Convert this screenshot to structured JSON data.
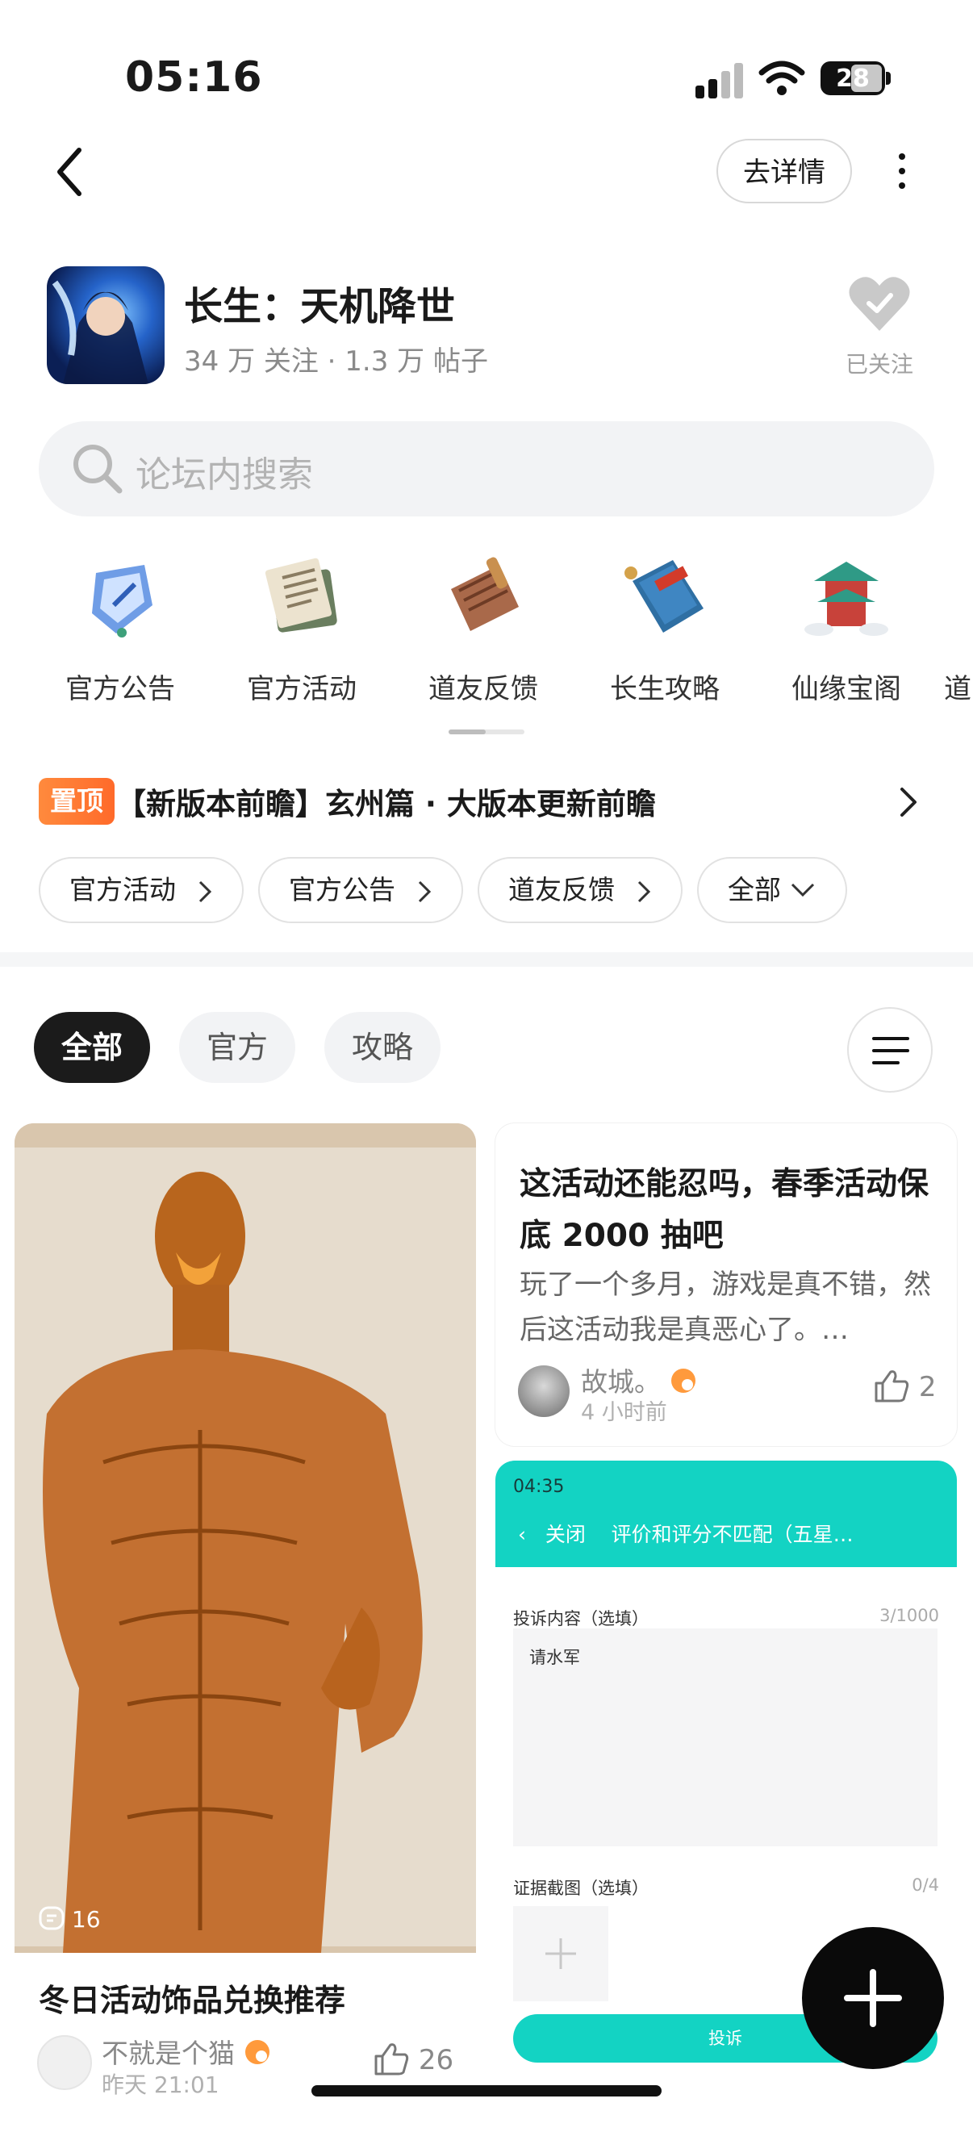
{
  "status": {
    "time": "05:16",
    "battery": "28"
  },
  "header": {
    "detail_label": "去详情"
  },
  "forum": {
    "name": "长生：天机降世",
    "stats": "34 万 关注 · 1.3 万 帖子",
    "follow_label": "已关注"
  },
  "search": {
    "placeholder": "论坛内搜索"
  },
  "categories": [
    "官方公告",
    "官方活动",
    "道友反馈",
    "长生攻略",
    "仙缘宝阁",
    "道"
  ],
  "pinned": {
    "badge": "置顶",
    "title": "【新版本前瞻】玄州篇 · 大版本更新前瞻"
  },
  "chips": [
    "官方活动",
    "官方公告",
    "道友反馈",
    "全部"
  ],
  "tabs": [
    "全部",
    "官方",
    "攻略"
  ],
  "posts": [
    {
      "title": "冬日活动饰品兑换推荐",
      "user": "不就是个猫",
      "time": "昨天 21:01",
      "likes": "26",
      "comments": "16"
    },
    {
      "title": "这活动还能忍吗，春季活动保底 2000 抽吧",
      "excerpt": "玩了一个多月，游戏是真不错，然后这活动我是真恶心了。…",
      "user": "故城。",
      "time": "4 小时前",
      "likes": "2"
    }
  ],
  "screenshot": {
    "time": "04:35",
    "close": "关闭",
    "title": "评价和评分不匹配（五星…",
    "content_label": "投诉内容（选填）",
    "content_count": "3/1000",
    "content_text": "请水军",
    "evidence_label": "证据截图（选填）",
    "evidence_count": "0/4",
    "submit": "投诉"
  },
  "colors": {
    "accent_orange": "#ff7a33",
    "teal": "#13d3c3",
    "dark": "#1b1b1b"
  }
}
